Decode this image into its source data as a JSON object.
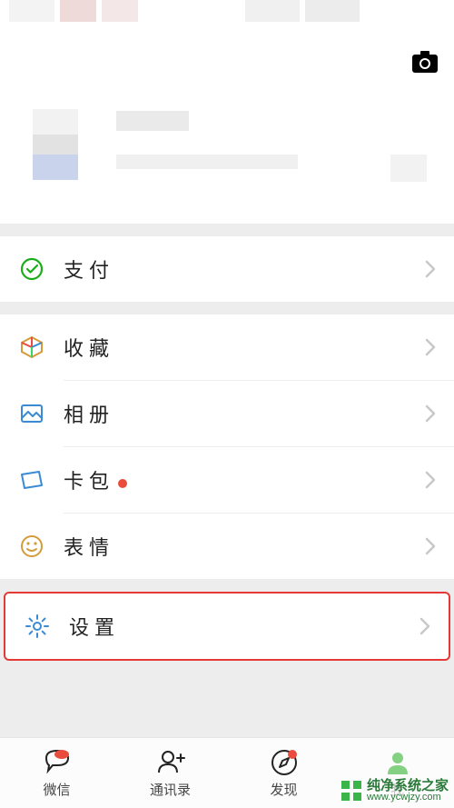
{
  "header": {
    "camera_icon": "camera"
  },
  "menu": {
    "pay": "支付",
    "favorites": "收藏",
    "album": "相册",
    "cards": "卡包",
    "cards_has_dot": true,
    "stickers": "表情",
    "settings": "设置"
  },
  "tabs": {
    "chats": "微信",
    "contacts": "通讯录",
    "discover": "发现",
    "me": "我"
  },
  "watermark": {
    "text": "纯净系统之家",
    "url": "www.ycwjzy.com"
  }
}
